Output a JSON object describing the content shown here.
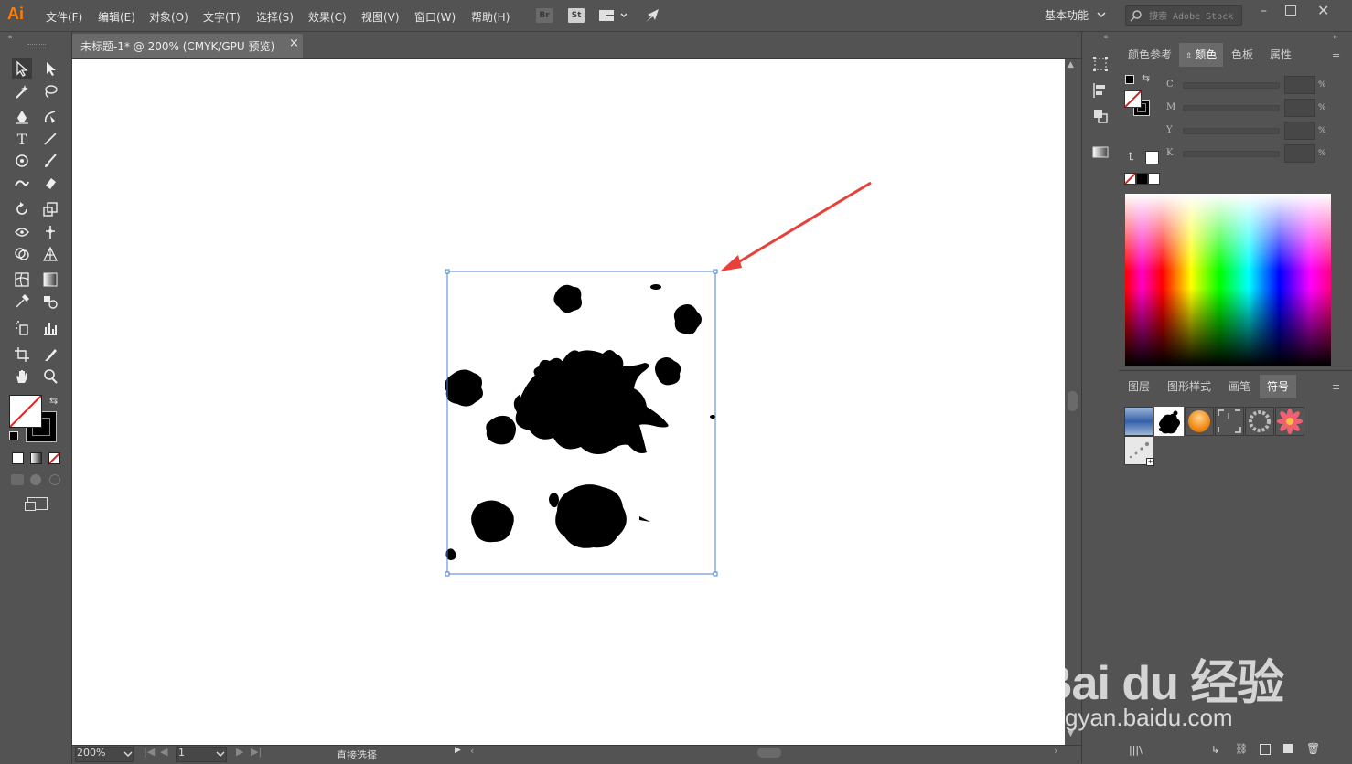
{
  "app": {
    "logo": "Ai"
  },
  "menu": [
    "文件(F)",
    "编辑(E)",
    "对象(O)",
    "文字(T)",
    "选择(S)",
    "效果(C)",
    "视图(V)",
    "窗口(W)",
    "帮助(H)"
  ],
  "topbar": {
    "bridge": "Br",
    "stock": "St",
    "workspace": "基本功能",
    "search_placeholder": "搜索 Adobe Stock"
  },
  "document_tab": {
    "title": "未标题-1* @ 200% (CMYK/GPU 预览)",
    "close": "×"
  },
  "status": {
    "zoom": "200%",
    "artboard": "1",
    "tool": "直接选择"
  },
  "color_panel": {
    "tabs": [
      "颜色参考",
      "颜色",
      "色板",
      "属性"
    ],
    "active_tab": "颜色",
    "channels": [
      "C",
      "M",
      "Y",
      "K"
    ],
    "percent": "%"
  },
  "symbols_panel": {
    "tabs": [
      "图层",
      "图形样式",
      "画笔",
      "符号"
    ],
    "active_tab": "符号"
  },
  "colors": {
    "accent": "#ff7c00",
    "selection": "#4a7fd0",
    "arrow": "#e8403a"
  },
  "watermark": {
    "brand": "Bai du 经验",
    "url": "jingyan.baidu.com"
  }
}
